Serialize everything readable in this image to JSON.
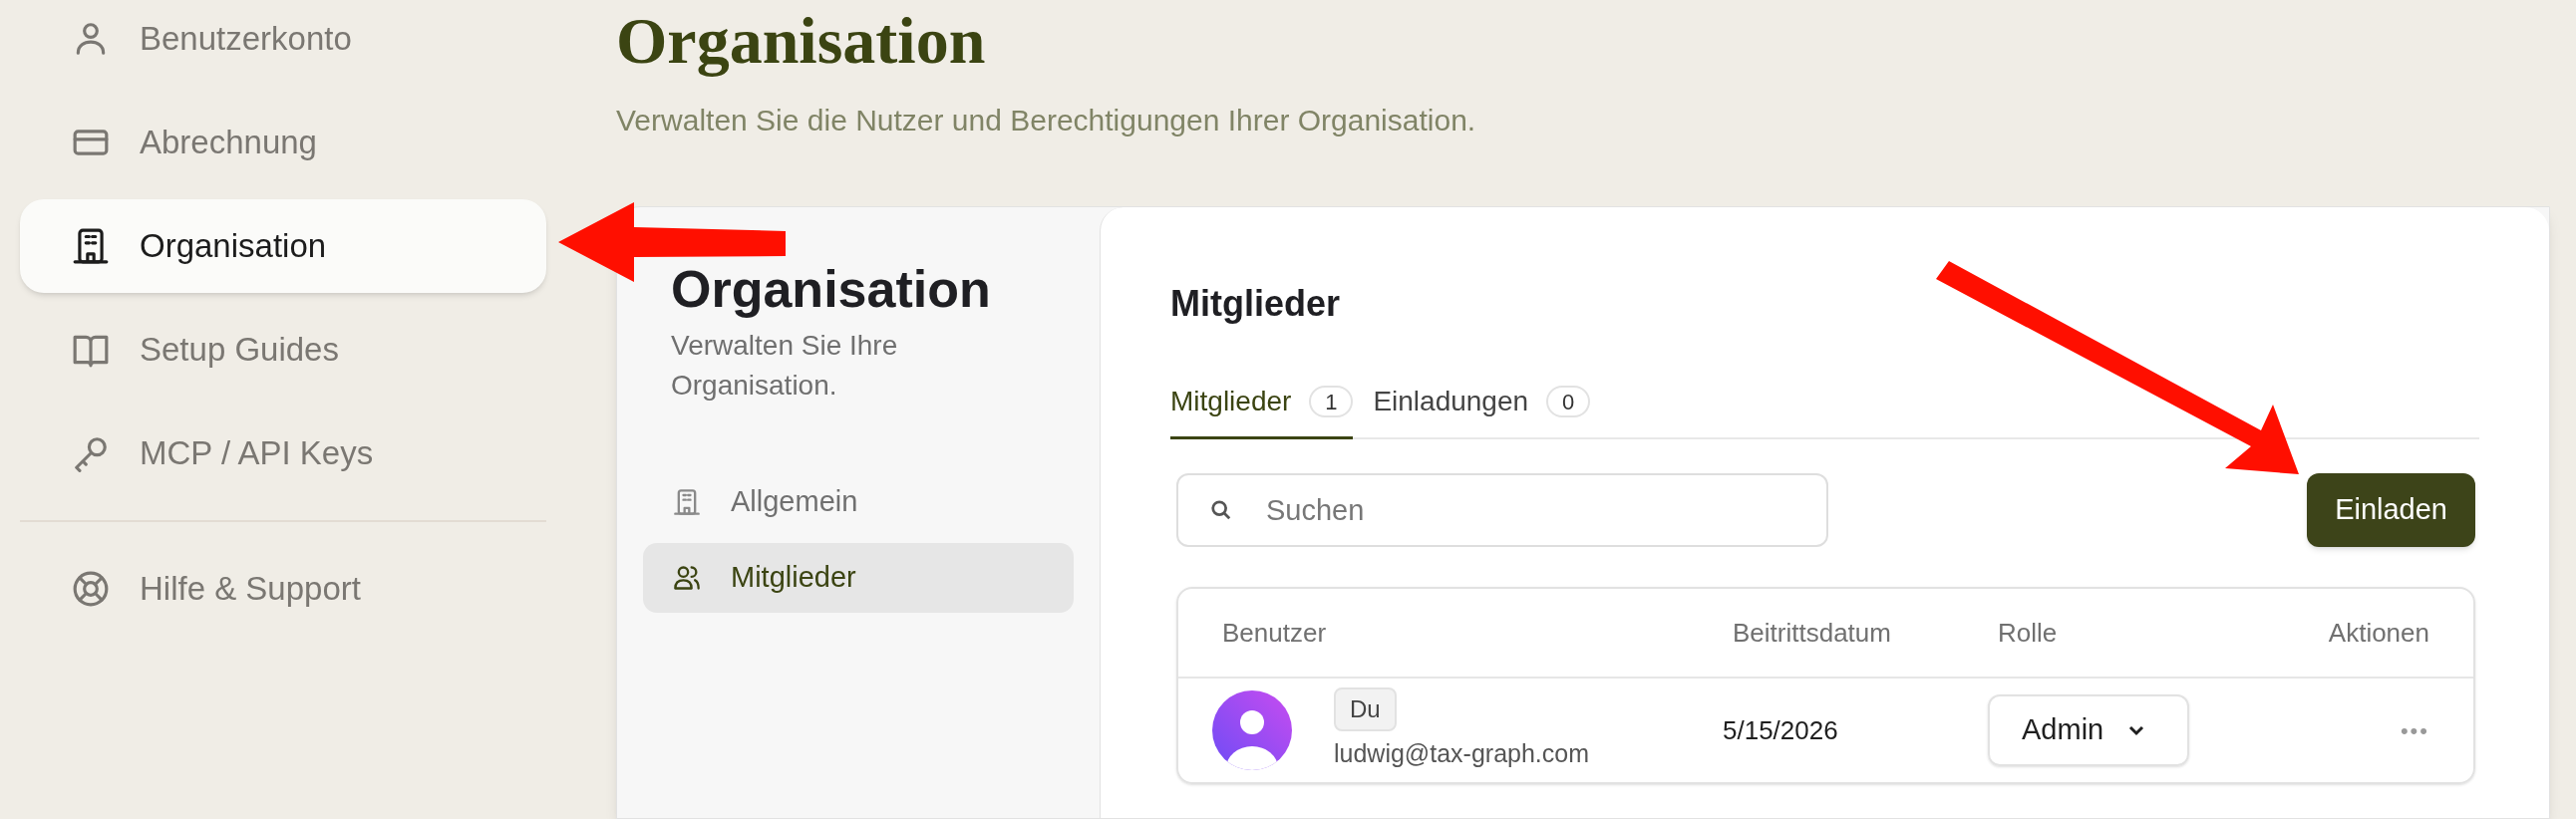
{
  "sidebar": {
    "items": [
      {
        "label": "Benutzerkonto",
        "kind": "user",
        "selected": false
      },
      {
        "label": "Abrechnung",
        "kind": "card",
        "selected": false
      },
      {
        "label": "Organisation",
        "kind": "building",
        "selected": true
      },
      {
        "label": "Setup Guides",
        "kind": "book",
        "selected": false
      },
      {
        "label": "MCP / API Keys",
        "kind": "key",
        "selected": false
      }
    ],
    "footer_items": [
      {
        "label": "Hilfe & Support",
        "kind": "lifebuoy",
        "selected": false
      }
    ]
  },
  "header": {
    "title": "Organisation",
    "subtitle": "Verwalten Sie die Nutzer und Berechtigungen Ihrer Organisation."
  },
  "settings_panel": {
    "title": "Organisation",
    "subtitle": "Verwalten Sie Ihre Organisation.",
    "nav": [
      {
        "label": "Allgemein",
        "kind": "building",
        "selected": false
      },
      {
        "label": "Mitglieder",
        "kind": "users",
        "selected": true
      }
    ]
  },
  "members": {
    "title": "Mitglieder",
    "tabs": [
      {
        "label": "Mitglieder",
        "count": "1",
        "selected": true
      },
      {
        "label": "Einladungen",
        "count": "0",
        "selected": false
      }
    ],
    "search": {
      "placeholder": "Suchen"
    },
    "invite_button": "Einladen",
    "table": {
      "columns": [
        "Benutzer",
        "Beitrittsdatum",
        "Rolle",
        "Aktionen"
      ],
      "rows": [
        {
          "badge": "Du",
          "email": "ludwig@tax-graph.com",
          "joined": "5/15/2026",
          "role": "Admin",
          "actions": "•••"
        }
      ]
    }
  }
}
